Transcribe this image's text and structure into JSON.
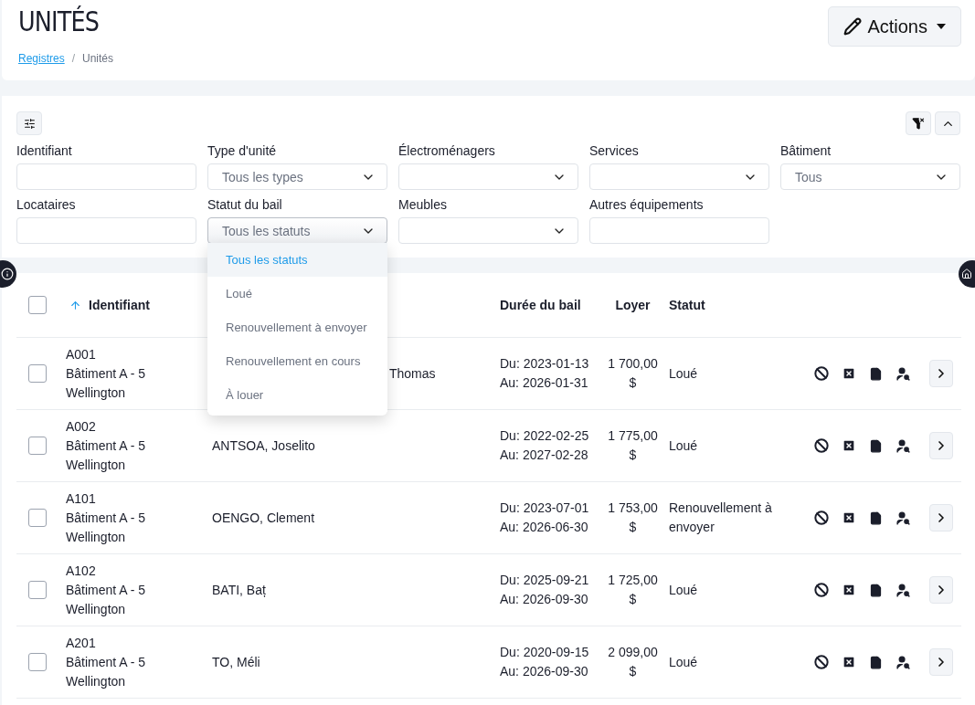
{
  "header": {
    "title": "UNITÉS",
    "separator": "/",
    "breadcrumb": [
      {
        "label": "Registres",
        "kind": "link"
      },
      {
        "label": "Unités",
        "kind": "current"
      }
    ],
    "actions_button": "Actions"
  },
  "filters": [
    {
      "label": "Identifiant",
      "kind": "text"
    },
    {
      "label": "Type d'unité",
      "kind": "select",
      "value": "Tous les types",
      "open": false
    },
    {
      "label": "Électroménagers",
      "kind": "select",
      "open": false
    },
    {
      "label": "Services",
      "kind": "select",
      "open": false
    },
    {
      "label": "Bâtiment",
      "kind": "select",
      "value": "Tous",
      "open": false
    },
    {
      "label": "Locataires",
      "kind": "text"
    },
    {
      "label": "Statut du bail",
      "kind": "select",
      "value": "Tous les statuts",
      "open": true
    },
    {
      "label": "Meubles",
      "kind": "select",
      "open": false
    },
    {
      "label": "Autres équipements",
      "kind": "text"
    }
  ],
  "dropdown_options": [
    {
      "label": "Tous les statuts",
      "selected": true
    },
    {
      "label": "Loué",
      "selected": false
    },
    {
      "label": "Renouvellement à envoyer",
      "selected": false
    },
    {
      "label": "Renouvellement en cours",
      "selected": false
    },
    {
      "label": "À louer",
      "selected": false
    }
  ],
  "table": {
    "select_all_checked": false,
    "columns": [
      "Identifiant",
      "Durée du bail",
      "Loyer",
      "Statut"
    ],
    "rows": [
      {
        "checked": false,
        "id": "A001",
        "building": "Bâtiment A - 5",
        "city": "Wellington",
        "tenant": "Thomas",
        "covered": true,
        "from": "Du: 2023-01-13",
        "to": "Au: 2026-01-31",
        "rent": "1 700,00",
        "currency": "$",
        "status": "Loué"
      },
      {
        "checked": false,
        "id": "A002",
        "building": "Bâtiment A - 5",
        "city": "Wellington",
        "tenant": "ANTSOA, Joselito",
        "covered": false,
        "from": "Du: 2022-02-25",
        "to": "Au: 2027-02-28",
        "rent": "1 775,00",
        "currency": "$",
        "status": "Loué"
      },
      {
        "checked": false,
        "id": "A101",
        "building": "Bâtiment A - 5",
        "city": "Wellington",
        "tenant": "OENGO, Clement",
        "covered": false,
        "from": "Du: 2023-07-01",
        "to": "Au: 2026-06-30",
        "rent": "1 753,00",
        "currency": "$",
        "status": "Renouvellement à envoyer"
      },
      {
        "checked": false,
        "id": "A102",
        "building": "Bâtiment A - 5",
        "city": "Wellington",
        "tenant": "BATI, Baț",
        "covered": false,
        "from": "Du: 2025-09-21",
        "to": "Au: 2026-09-30",
        "rent": "1 725,00",
        "currency": "$",
        "status": "Loué"
      },
      {
        "checked": false,
        "id": "A201",
        "building": "Bâtiment A - 5",
        "city": "Wellington",
        "tenant": "TO, Méli",
        "covered": false,
        "from": "Du: 2020-09-15",
        "to": "Au: 2026-09-30",
        "rent": "2 099,00",
        "currency": "$",
        "status": "Loué"
      }
    ]
  }
}
